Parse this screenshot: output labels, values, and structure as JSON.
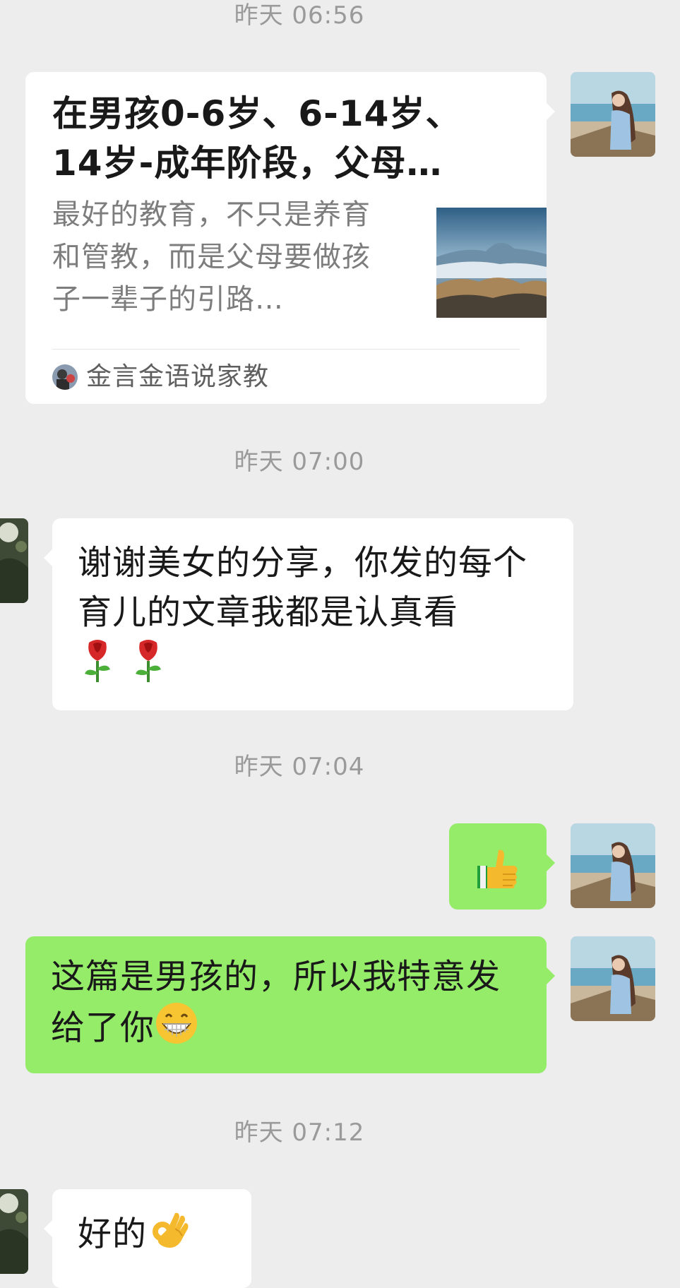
{
  "colors": {
    "background": "#ededed",
    "bubble_white": "#ffffff",
    "bubble_green": "#95ec69",
    "timestamp": "#9a9a9a"
  },
  "messages": [
    {
      "timestamp": "昨天  06:56",
      "sender": "self",
      "type": "article-card",
      "card": {
        "title": "在男孩0-6岁、6-14岁、14岁-成年阶段，父母…",
        "description": "最好的教育，不只是养育和管教，而是父母要做孩子一辈子的引路…",
        "source": "金言金语说家教",
        "thumbnail_icon": "mountain-landscape-thumbnail",
        "source_icon": "account-avatar-icon"
      }
    },
    {
      "timestamp": "昨天  07:00",
      "sender": "peer",
      "type": "text",
      "text": "谢谢美女的分享，你发的每个育儿的文章我都是认真看",
      "emoji": [
        "rose-emoji",
        "rose-emoji"
      ]
    },
    {
      "timestamp": "昨天  07:04",
      "sender": "self",
      "type": "emoji",
      "emoji": "thumbs-up-emoji"
    },
    {
      "sender": "self",
      "type": "text",
      "text": "这篇是男孩的，所以我特意发给了你",
      "emoji": "grin-emoji"
    },
    {
      "timestamp": "昨天  07:12",
      "sender": "peer",
      "type": "text",
      "text": "好的",
      "emoji": "ok-hand-emoji"
    }
  ]
}
